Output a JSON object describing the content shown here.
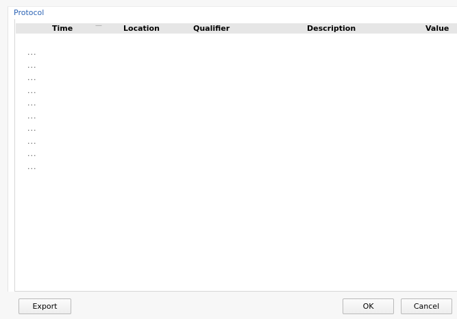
{
  "window": {
    "title": "Protocol"
  },
  "table": {
    "columns": [
      {
        "label": "Time"
      },
      {
        "label": "Location"
      },
      {
        "label": "Qualifier"
      },
      {
        "label": "Description"
      },
      {
        "label": "Value"
      }
    ],
    "sort_icon": "sort-indicator-icon",
    "rows": [
      "...",
      "...",
      "...",
      "...",
      "...",
      "...",
      "...",
      "...",
      "...",
      "..."
    ]
  },
  "footer": {
    "export_label": "Export",
    "ok_label": "OK",
    "cancel_label": "Cancel"
  },
  "colors": {
    "title": "#2a62b4",
    "header_bg": "#e6e6e6"
  }
}
